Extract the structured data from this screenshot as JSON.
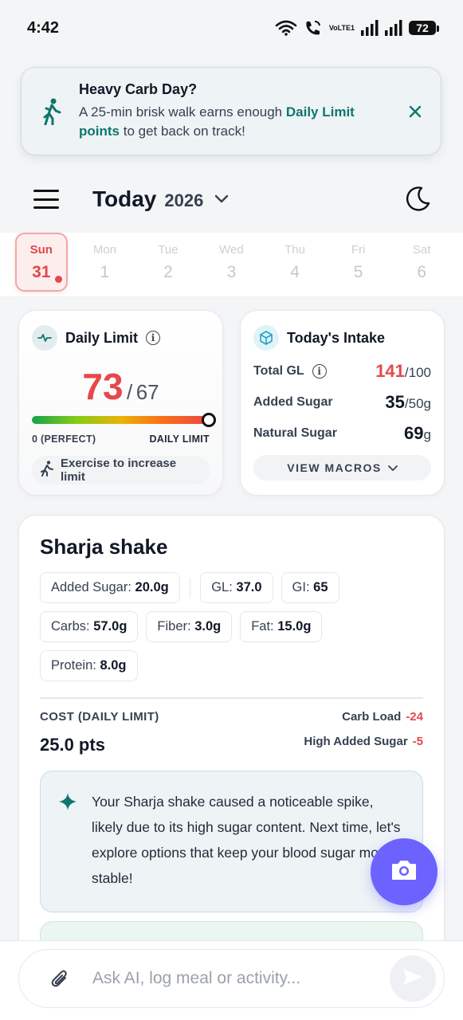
{
  "status_bar": {
    "time": "4:42",
    "volte_top": "Vo",
    "volte_bottom": "LTE1",
    "battery": "72"
  },
  "banner": {
    "title": "Heavy Carb Day?",
    "body_prefix": "A 25-min brisk walk earns enough ",
    "body_highlight": "Daily Limit points",
    "body_suffix": " to get back on track!",
    "icon": "walking-icon",
    "accent": "#0f766e"
  },
  "header": {
    "title": "Today",
    "year": "2026"
  },
  "week": [
    {
      "name": "Sun",
      "num": "31"
    },
    {
      "name": "Mon",
      "num": "1"
    },
    {
      "name": "Tue",
      "num": "2"
    },
    {
      "name": "Wed",
      "num": "3"
    },
    {
      "name": "Thu",
      "num": "4"
    },
    {
      "name": "Fri",
      "num": "5"
    },
    {
      "name": "Sat",
      "num": "6"
    }
  ],
  "daily_limit": {
    "title": "Daily Limit",
    "value": "73",
    "separator": "/",
    "max": "67",
    "label_left": "0 (PERFECT)",
    "label_right": "DAILY LIMIT",
    "exercise_label": "Exercise to increase limit",
    "value_color": "#e5484d"
  },
  "intake": {
    "title": "Today's Intake",
    "rows": [
      {
        "label": "Total GL",
        "value": "141",
        "unit": "/100"
      },
      {
        "label": "Added Sugar",
        "value": "35",
        "unit": "/50g"
      },
      {
        "label": "Natural Sugar",
        "value": "69",
        "unit": "g"
      }
    ],
    "view_macros": "VIEW MACROS"
  },
  "food": {
    "name": "Sharja shake",
    "chips": [
      {
        "label": "Added Sugar:",
        "value": "20.0g"
      },
      {
        "label": "GL:",
        "value": "37.0"
      },
      {
        "label": "GI:",
        "value": "65"
      },
      {
        "label": "Carbs:",
        "value": "57.0g"
      },
      {
        "label": "Fiber:",
        "value": "3.0g"
      },
      {
        "label": "Fat:",
        "value": "15.0g"
      },
      {
        "label": "Protein:",
        "value": "8.0g"
      }
    ],
    "cost_label": "COST (DAILY LIMIT)",
    "cost_value": "25.0 pts",
    "penalties": [
      {
        "label": "Carb Load",
        "value": "-24"
      },
      {
        "label": "High Added Sugar",
        "value": "-5"
      }
    ],
    "ai_text": "Your Sharja shake caused a noticeable spike, likely due to its high sugar content. Next time, let's explore options that keep your blood sugar more stable!"
  },
  "chat": {
    "placeholder": "Ask AI, log meal or activity..."
  },
  "colors": {
    "brand_purple": "#6c63ff",
    "danger": "#e5484d",
    "teal": "#0f766e"
  }
}
